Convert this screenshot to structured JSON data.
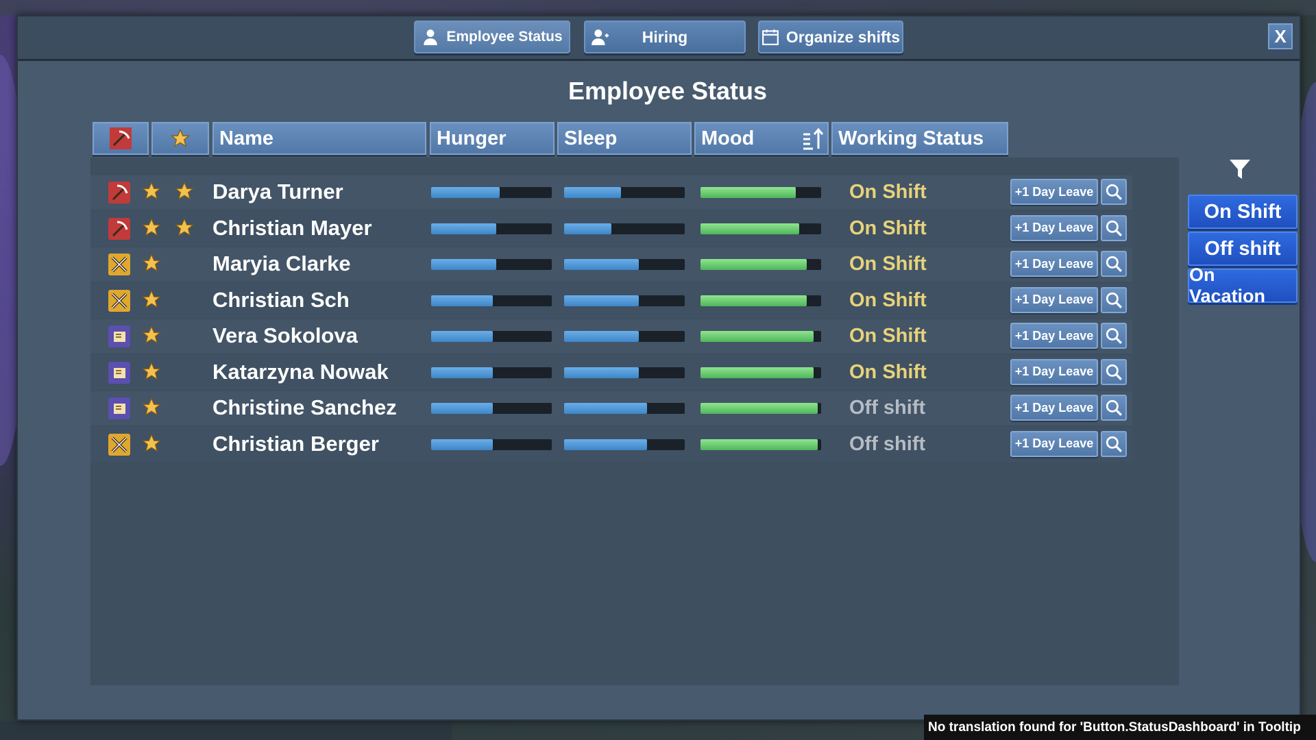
{
  "tabs": [
    {
      "label": "Employee Status",
      "icon": "person-icon",
      "active": true
    },
    {
      "label": "Hiring",
      "icon": "add-person-icon",
      "active": false
    },
    {
      "label": "Organize shifts",
      "icon": "calendar-icon",
      "active": false
    }
  ],
  "close_label": "X",
  "title": "Employee Status",
  "columns": {
    "role": "role-filter-icon",
    "rating": "star-icon",
    "name": "Name",
    "hunger": "Hunger",
    "sleep": "Sleep",
    "mood": "Mood",
    "working_status": "Working Status"
  },
  "employees": [
    {
      "role": "pickaxe",
      "stars": 2,
      "name": "Darya Turner",
      "hunger": 0.57,
      "sleep": 0.47,
      "mood": 0.79,
      "status": "On Shift",
      "on": true
    },
    {
      "role": "pickaxe",
      "stars": 2,
      "name": "Christian Mayer",
      "hunger": 0.54,
      "sleep": 0.39,
      "mood": 0.82,
      "status": "On Shift",
      "on": true
    },
    {
      "role": "tools",
      "stars": 1,
      "name": "Maryia Clarke",
      "hunger": 0.54,
      "sleep": 0.62,
      "mood": 0.88,
      "status": "On Shift",
      "on": true
    },
    {
      "role": "tools",
      "stars": 1,
      "name": "Christian Sch",
      "hunger": 0.51,
      "sleep": 0.62,
      "mood": 0.88,
      "status": "On Shift",
      "on": true
    },
    {
      "role": "cashier",
      "stars": 1,
      "name": "Vera Sokolova",
      "hunger": 0.51,
      "sleep": 0.62,
      "mood": 0.94,
      "status": "On Shift",
      "on": true
    },
    {
      "role": "cashier",
      "stars": 1,
      "name": "Katarzyna Nowak",
      "hunger": 0.51,
      "sleep": 0.62,
      "mood": 0.94,
      "status": "On Shift",
      "on": true
    },
    {
      "role": "cashier",
      "stars": 1,
      "name": "Christine Sanchez",
      "hunger": 0.51,
      "sleep": 0.69,
      "mood": 0.97,
      "status": "Off shift",
      "on": false
    },
    {
      "role": "tools",
      "stars": 1,
      "name": "Christian Berger",
      "hunger": 0.51,
      "sleep": 0.69,
      "mood": 0.97,
      "status": "Off shift",
      "on": false
    }
  ],
  "leave_label": "+1 Day Leave",
  "filters": [
    "On Shift",
    "Off shift",
    "On Vacation"
  ],
  "tooltip": "No translation found for 'Button.StatusDashboard' in Tooltip",
  "colors": {
    "on_shift": "#e8d37a",
    "off_shift": "#b6bcc4",
    "bar_blue": "#4a90d0",
    "bar_green": "#5cc468",
    "filter_button": "#2a5fd6"
  }
}
